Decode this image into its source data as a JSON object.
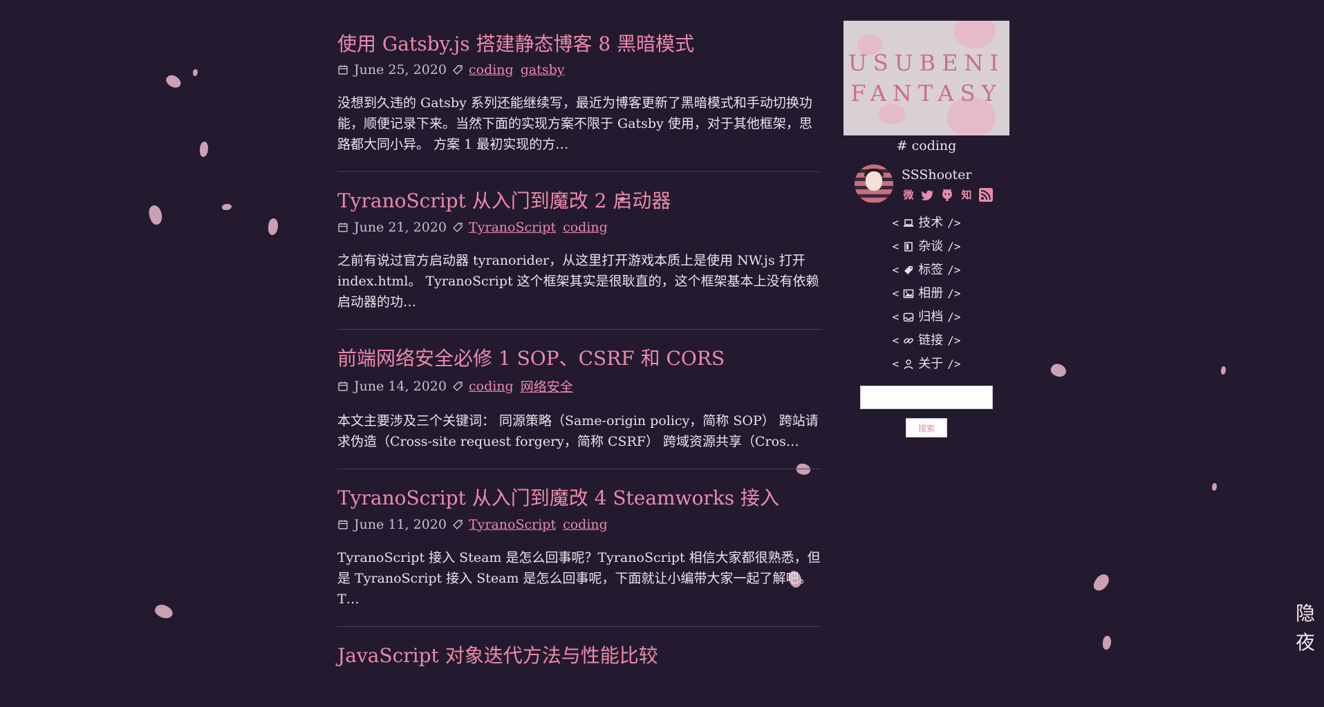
{
  "posts": [
    {
      "title": "使用 Gatsby.js 搭建静态博客 8 黑暗模式",
      "date": "June 25, 2020",
      "tags": [
        "coding",
        "gatsby"
      ],
      "excerpt": "没想到久违的 Gatsby 系列还能继续写，最近为博客更新了黑暗模式和手动切换功能，顺便记录下来。当然下面的实现方案不限于 Gatsby 使用，对于其他框架，思路都大同小异。 方案 1 最初实现的方…"
    },
    {
      "title": "TyranoScript 从入门到魔改 2 启动器",
      "date": "June 21, 2020",
      "tags": [
        "TyranoScript",
        "coding"
      ],
      "excerpt": "之前有说过官方启动器 tyranorider，从这里打开游戏本质上是使用 NW.js 打开 index.html。 TyranoScript 这个框架其实是很耿直的，这个框架基本上没有依赖启动器的功…"
    },
    {
      "title": "前端网络安全必修 1 SOP、CSRF 和 CORS",
      "date": "June 14, 2020",
      "tags": [
        "coding",
        "网络安全"
      ],
      "excerpt": "本文主要涉及三个关键词： 同源策略（Same-origin policy，简称 SOP） 跨站请求伪造（Cross-site request forgery，简称 CSRF） 跨域资源共享（Cros…"
    },
    {
      "title": "TyranoScript 从入门到魔改 4 Steamworks 接入",
      "date": "June 11, 2020",
      "tags": [
        "TyranoScript",
        "coding"
      ],
      "excerpt": "TyranoScript 接入 Steam 是怎么回事呢？TyranoScript 相信大家都很熟悉，但是 TyranoScript 接入 Steam 是怎么回事呢，下面就让小编带大家一起了解吧。T…"
    },
    {
      "title": "JavaScript 对象迭代方法与性能比较",
      "date": "",
      "tags": [],
      "excerpt": ""
    }
  ],
  "sidebar": {
    "logo_line1": "USUBENI",
    "logo_line2": "FANTASY",
    "current_tag": "# coding",
    "author": "SSShooter",
    "socials": [
      {
        "name": "weibo-icon",
        "glyph": "微"
      },
      {
        "name": "twitter-icon",
        "glyph": "t"
      },
      {
        "name": "github-icon",
        "glyph": "g"
      },
      {
        "name": "zhihu-icon",
        "glyph": "知"
      },
      {
        "name": "rss-icon",
        "glyph": "r"
      }
    ],
    "nav": [
      {
        "label": "技术",
        "icon": "laptop-icon"
      },
      {
        "label": "杂谈",
        "icon": "book-icon"
      },
      {
        "label": "标签",
        "icon": "tag-icon"
      },
      {
        "label": "相册",
        "icon": "image-icon"
      },
      {
        "label": "归档",
        "icon": "inbox-icon"
      },
      {
        "label": "链接",
        "icon": "link-icon"
      },
      {
        "label": "关于",
        "icon": "user-icon"
      }
    ],
    "bracket_open": "<",
    "bracket_close": "/>",
    "search_placeholder": "",
    "search_button": "搜索"
  },
  "night_toggle": {
    "line1": "隐",
    "line2": "夜"
  },
  "colors": {
    "background": "#231a30",
    "accent": "#ec8aab",
    "text": "#ece3ea"
  }
}
